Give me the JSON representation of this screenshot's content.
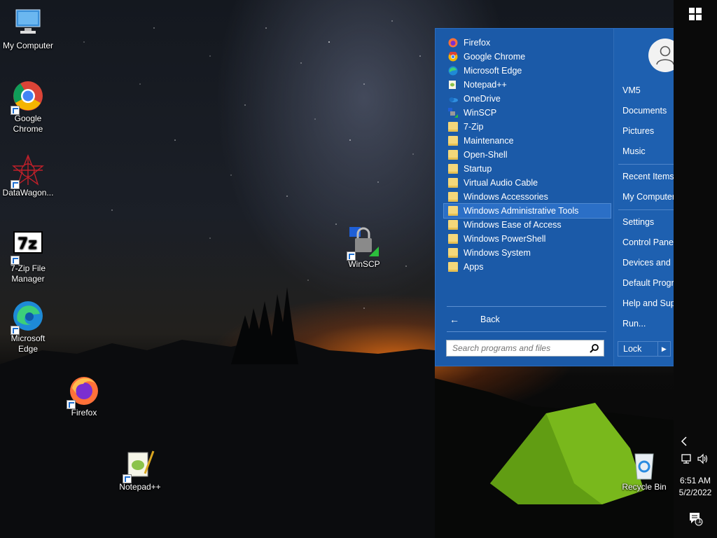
{
  "desktop": {
    "icons": [
      {
        "label": "My Computer"
      },
      {
        "label": "Google Chrome"
      },
      {
        "label": "DataWagon..."
      },
      {
        "label": "7-Zip File Manager"
      },
      {
        "label": "Microsoft Edge"
      },
      {
        "label": "Firefox"
      },
      {
        "label": "Notepad++"
      },
      {
        "label": "WinSCP"
      },
      {
        "label": "Recycle Bin"
      }
    ]
  },
  "start_menu": {
    "programs": [
      {
        "label": "Firefox",
        "icon": "firefox-icon"
      },
      {
        "label": "Google Chrome",
        "icon": "chrome-icon"
      },
      {
        "label": "Microsoft Edge",
        "icon": "edge-icon"
      },
      {
        "label": "Notepad++",
        "icon": "notepad-icon"
      },
      {
        "label": "OneDrive",
        "icon": "onedrive-icon"
      },
      {
        "label": "WinSCP",
        "icon": "winscp-icon"
      },
      {
        "label": "7-Zip",
        "icon": "folder-icon"
      },
      {
        "label": "Maintenance",
        "icon": "folder-icon"
      },
      {
        "label": "Open-Shell",
        "icon": "folder-icon"
      },
      {
        "label": "Startup",
        "icon": "folder-icon"
      },
      {
        "label": "Virtual Audio Cable",
        "icon": "folder-icon"
      },
      {
        "label": "Windows Accessories",
        "icon": "folder-icon"
      },
      {
        "label": "Windows Administrative Tools",
        "icon": "folder-icon",
        "highlighted": true
      },
      {
        "label": "Windows Ease of Access",
        "icon": "folder-icon"
      },
      {
        "label": "Windows PowerShell",
        "icon": "folder-icon"
      },
      {
        "label": "Windows System",
        "icon": "folder-icon"
      },
      {
        "label": "Apps",
        "icon": "apps-icon"
      }
    ],
    "back_label": "Back",
    "search_placeholder": "Search programs and files",
    "right": {
      "user": "VM5",
      "documents": "Documents",
      "pictures": "Pictures",
      "music": "Music",
      "recent_items": "Recent Items",
      "my_computer": "My Computer",
      "settings": "Settings",
      "control_panel": "Control Panel",
      "devices_printers": "Devices and Printers",
      "default_programs": "Default Programs",
      "help_support": "Help and Support",
      "run": "Run...",
      "lock": "Lock"
    }
  },
  "taskbar": {
    "time": "6:51 AM",
    "date": "5/2/2022",
    "notification_count": "1"
  },
  "colors": {
    "menu_bg": "#1b5aa8",
    "highlight": "#2b6fc6",
    "taskbar": "#0a0a0a"
  }
}
